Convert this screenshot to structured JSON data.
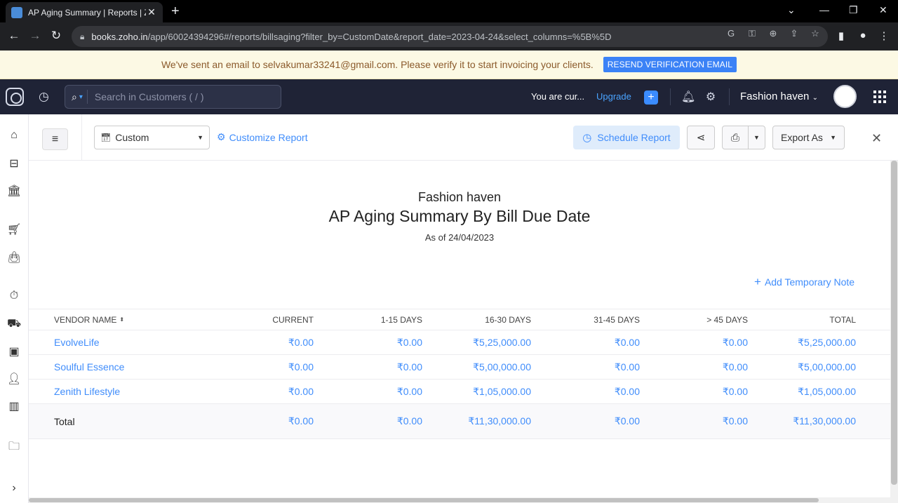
{
  "browser": {
    "tab_title": "AP Aging Summary | Reports | Zo",
    "tab_close": "✕",
    "new_tab": "+",
    "url_host": "books.zoho.in",
    "url_path": "/app/60024394296#/reports/billsaging?filter_by=CustomDate&report_date=2023-04-24&select_columns=%5B%5D"
  },
  "notice": {
    "message": "We've sent an email to selvakumar33241@gmail.com. Please verify it to start invoicing your clients.",
    "button": "RESEND VERIFICATION EMAIL"
  },
  "header": {
    "search_placeholder": "Search in Customers ( / )",
    "trial_text": "You are cur...",
    "upgrade": "Upgrade",
    "org_name": "Fashion haven"
  },
  "toolbar": {
    "date_filter": "Custom",
    "customize": "Customize Report",
    "schedule": "Schedule Report",
    "export": "Export As"
  },
  "report": {
    "org": "Fashion haven",
    "title": "AP Aging Summary By Bill Due Date",
    "as_of": "As of 24/04/2023",
    "add_note": "Add Temporary Note",
    "columns": [
      "VENDOR NAME",
      "CURRENT",
      "1-15 DAYS",
      "16-30 DAYS",
      "31-45 DAYS",
      "> 45 DAYS",
      "TOTAL"
    ],
    "rows": [
      [
        "EvolveLife",
        "₹0.00",
        "₹0.00",
        "₹5,25,000.00",
        "₹0.00",
        "₹0.00",
        "₹5,25,000.00"
      ],
      [
        "Soulful Essence",
        "₹0.00",
        "₹0.00",
        "₹5,00,000.00",
        "₹0.00",
        "₹0.00",
        "₹5,00,000.00"
      ],
      [
        "Zenith Lifestyle",
        "₹0.00",
        "₹0.00",
        "₹1,05,000.00",
        "₹0.00",
        "₹0.00",
        "₹1,05,000.00"
      ]
    ],
    "total": [
      "Total",
      "₹0.00",
      "₹0.00",
      "₹11,30,000.00",
      "₹0.00",
      "₹0.00",
      "₹11,30,000.00"
    ]
  },
  "colors": {
    "accent": "#408dfb",
    "header_bg": "#1f2336",
    "banner_bg": "#fcf9e4"
  }
}
